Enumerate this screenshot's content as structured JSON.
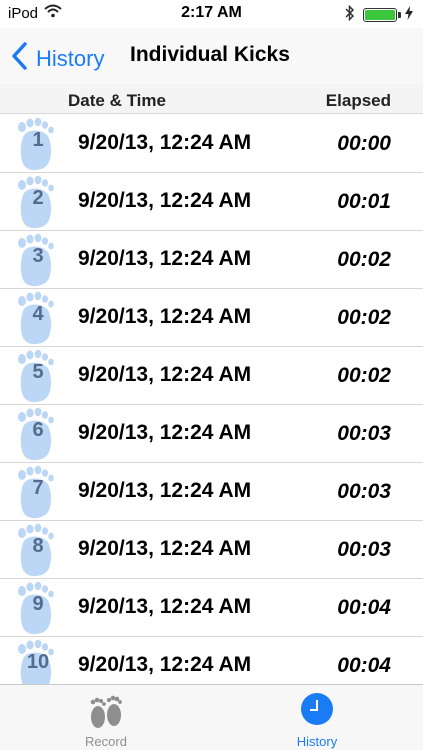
{
  "status_bar": {
    "carrier": "iPod",
    "time": "2:17 AM"
  },
  "nav": {
    "back_label": "History",
    "title": "Individual Kicks"
  },
  "columns": {
    "date": "Date & Time",
    "elapsed": "Elapsed"
  },
  "kicks": [
    {
      "num": "1",
      "date": "9/20/13, 12:24 AM",
      "elapsed": "00:00"
    },
    {
      "num": "2",
      "date": "9/20/13, 12:24 AM",
      "elapsed": "00:01"
    },
    {
      "num": "3",
      "date": "9/20/13, 12:24 AM",
      "elapsed": "00:02"
    },
    {
      "num": "4",
      "date": "9/20/13, 12:24 AM",
      "elapsed": "00:02"
    },
    {
      "num": "5",
      "date": "9/20/13, 12:24 AM",
      "elapsed": "00:02"
    },
    {
      "num": "6",
      "date": "9/20/13, 12:24 AM",
      "elapsed": "00:03"
    },
    {
      "num": "7",
      "date": "9/20/13, 12:24 AM",
      "elapsed": "00:03"
    },
    {
      "num": "8",
      "date": "9/20/13, 12:24 AM",
      "elapsed": "00:03"
    },
    {
      "num": "9",
      "date": "9/20/13, 12:24 AM",
      "elapsed": "00:04"
    },
    {
      "num": "10",
      "date": "9/20/13, 12:24 AM",
      "elapsed": "00:04"
    }
  ],
  "tabs": {
    "record": "Record",
    "history": "History"
  },
  "colors": {
    "accent": "#1a7cf5",
    "foot": "#bcd6f5",
    "battery": "#3cc83c"
  }
}
